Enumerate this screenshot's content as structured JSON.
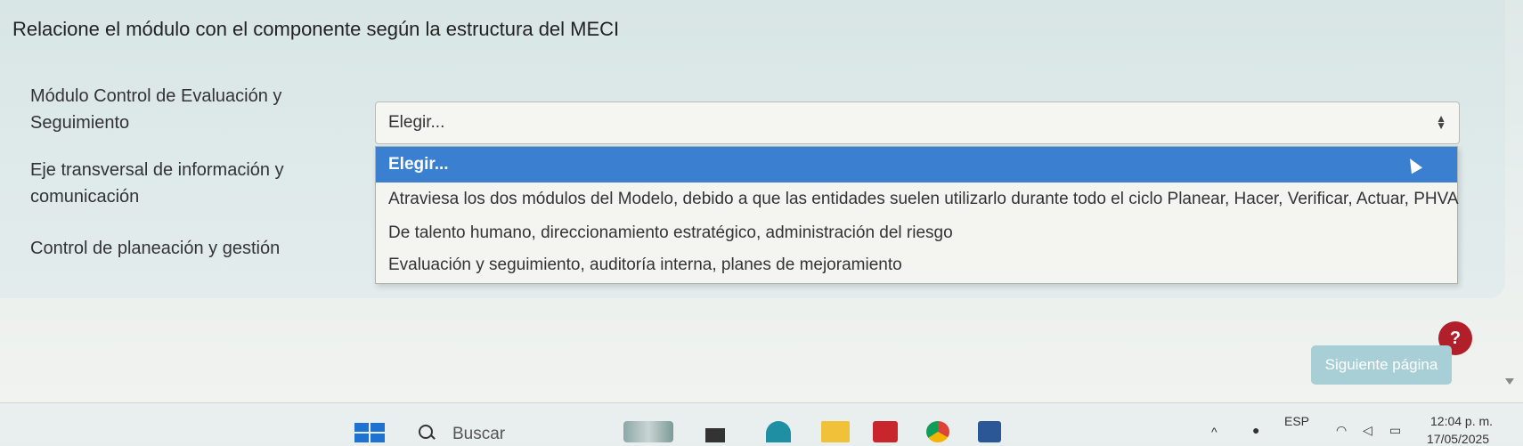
{
  "question": "Relacione el módulo con el componente según la estructura del MECI",
  "rows": [
    {
      "label": "Módulo Control de Evaluación y Seguimiento"
    },
    {
      "label": "Eje transversal de información y comunicación"
    },
    {
      "label": "Control de planeación y gestión"
    }
  ],
  "select": {
    "value": "Elegir..."
  },
  "dropdown": {
    "options": [
      "Elegir...",
      "Atraviesa los dos módulos del Modelo, debido a que las entidades suelen utilizarlo durante todo el ciclo Planear, Hacer, Verificar, Actuar, PHVA",
      "De talento humano, direccionamiento estratégico, administración del riesgo",
      "Evaluación y seguimiento, auditoría interna, planes de mejoramiento"
    ]
  },
  "help_label": "?",
  "next_button": "Siguiente página",
  "taskbar": {
    "search_placeholder": "Buscar",
    "language": "ESP",
    "time": "12:04 p. m.",
    "date": "17/05/2025"
  },
  "colors": {
    "highlight": "#3b7fd0",
    "help": "#b11f2a",
    "next": "#a8cfd6"
  }
}
